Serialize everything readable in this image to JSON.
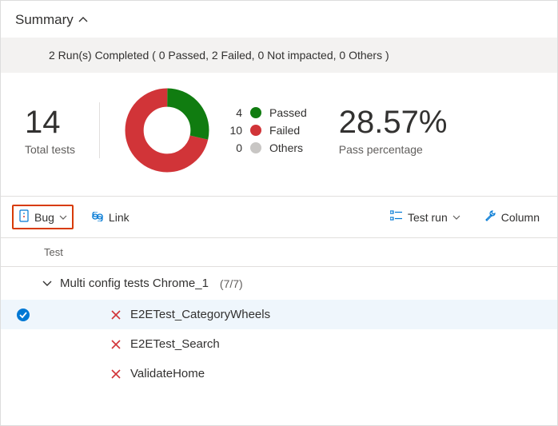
{
  "header": {
    "title": "Summary"
  },
  "status_bar": "2 Run(s) Completed ( 0 Passed, 2 Failed, 0 Not impacted, 0 Others )",
  "stats": {
    "total": {
      "value": "14",
      "label": "Total tests"
    },
    "pass": {
      "value": "28.57%",
      "label": "Pass percentage"
    }
  },
  "legend": {
    "passed": {
      "count": "4",
      "label": "Passed",
      "color": "#107c10"
    },
    "failed": {
      "count": "10",
      "label": "Failed",
      "color": "#d13438"
    },
    "others": {
      "count": "0",
      "label": "Others",
      "color": "#c8c6c4"
    }
  },
  "chart_data": {
    "type": "pie",
    "title": "",
    "series": [
      {
        "name": "Passed",
        "value": 4,
        "color": "#107c10"
      },
      {
        "name": "Failed",
        "value": 10,
        "color": "#d13438"
      },
      {
        "name": "Others",
        "value": 0,
        "color": "#c8c6c4"
      }
    ]
  },
  "toolbar": {
    "bug": "Bug",
    "link": "Link",
    "test_run": "Test run",
    "columns": "Column"
  },
  "columns": {
    "test": "Test"
  },
  "group": {
    "name": "Multi config tests Chrome_1",
    "count": "(7/7)"
  },
  "tests": [
    {
      "name": "E2ETest_CategoryWheels",
      "status": "failed",
      "selected": true
    },
    {
      "name": "E2ETest_Search",
      "status": "failed",
      "selected": false
    },
    {
      "name": "ValidateHome",
      "status": "failed",
      "selected": false
    }
  ]
}
